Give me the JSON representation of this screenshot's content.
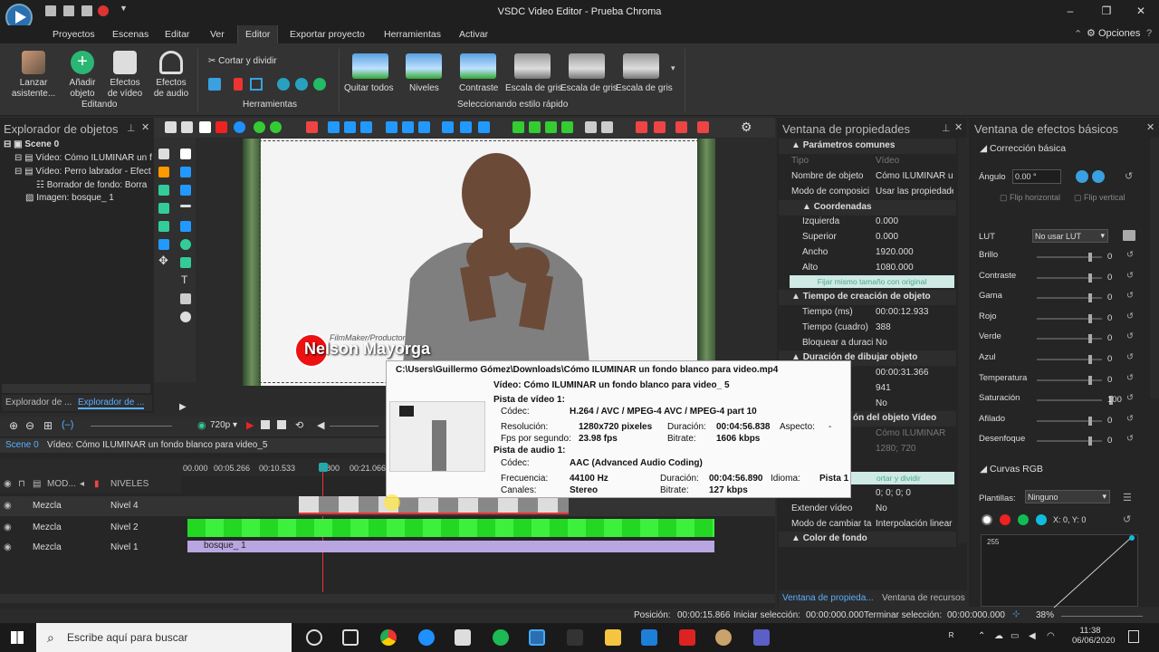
{
  "app": {
    "title": "VSDC Video Editor - Prueba Chroma",
    "options": "Opciones"
  },
  "menu": [
    "Proyectos",
    "Escenas",
    "Editar",
    "Ver",
    "Editor",
    "Exportar proyecto",
    "Herramientas",
    "Activar"
  ],
  "ribbon": {
    "launch": "Lanzar asistente...",
    "add": "Añadir objeto",
    "vfx": "Efectos de vídeo",
    "afx": "Efectos de audio",
    "cut": "Cortar y dividir",
    "group_edit": "Editando",
    "group_tools": "Herramientas",
    "group_style": "Seleccionando estilo rápido",
    "styles": [
      "Quitar todos",
      "Niveles",
      "Contraste",
      "Escala de gris",
      "Escala de gris",
      "Escala de gris"
    ]
  },
  "explorer": {
    "title": "Explorador de objetos",
    "items": [
      "Scene 0",
      "Vídeo: Cómo ILUMINAR un f",
      "Vídeo: Perro labrador - Efect",
      "Borrador de fondo: Borra",
      "Imagen: bosque_ 1"
    ],
    "tabs": [
      "Explorador de ...",
      "Explorador de ..."
    ]
  },
  "video_overlay": {
    "brand": "Nelson Mayorga",
    "sub": "FilmMaker/Productor"
  },
  "props": {
    "title": "Ventana de propiedades",
    "common": "Parámetros comunes",
    "rows": [
      [
        "Tipo",
        "Vídeo"
      ],
      [
        "Nombre de objeto",
        "Cómo ILUMINAR un"
      ],
      [
        "Modo de composici",
        "Usar las propiedades"
      ]
    ],
    "coords": "Coordenadas",
    "coord_rows": [
      [
        "Izquierda",
        "0.000"
      ],
      [
        "Superior",
        "0.000"
      ],
      [
        "Ancho",
        "1920.000"
      ],
      [
        "Alto",
        "1080.000"
      ]
    ],
    "fit_btn": "Fijar mismo tamaño con original",
    "time_sec": "Tiempo de creación de objeto",
    "time_rows": [
      [
        "Tiempo (ms)",
        "00:00:12.933"
      ],
      [
        "Tiempo (cuadro)",
        "388"
      ],
      [
        "Bloquear a duraci",
        "No"
      ]
    ],
    "draw_sec": "Duración de dibujar objeto",
    "draw_rows": [
      "00:00:31.366",
      "941",
      "No"
    ],
    "video_sec": "ón del objeto Vídeo",
    "extra": [
      "Cómo ILUMINAR",
      "1280; 720",
      "ortar y dividir",
      "0; 0; 0; 0"
    ],
    "bottom_rows": [
      [
        "Extender vídeo",
        "No"
      ],
      [
        "Modo de cambiar ta",
        "Interpolación linear"
      ]
    ],
    "bg_sec": "Color de fondo",
    "tabs": [
      "Ventana de propieda...",
      "Ventana de recursos"
    ]
  },
  "effects": {
    "title": "Ventana de efectos básicos",
    "section": "Corrección básica",
    "angle_label": "Ángulo",
    "angle_val": "0.00 °",
    "flip_h": "Flip horizontal",
    "flip_v": "Flip vertical",
    "lut_label": "LUT",
    "lut_val": "No usar LUT",
    "rows": [
      [
        "Brillo",
        "0"
      ],
      [
        "Contraste",
        "0"
      ],
      [
        "Gama",
        "0"
      ],
      [
        "Rojo",
        "0"
      ],
      [
        "Verde",
        "0"
      ],
      [
        "Azul",
        "0"
      ],
      [
        "Temperatura",
        "0"
      ],
      [
        "Saturación",
        "100"
      ],
      [
        "Afilado",
        "0"
      ],
      [
        "Desenfoque",
        "0"
      ]
    ],
    "curves": "Curvas RGB",
    "templates_label": "Plantillas:",
    "templates_val": "Ninguno",
    "coords": "X: 0, Y: 0",
    "curve_top": "255"
  },
  "timeline": {
    "res": "720p",
    "scene": "Scene 0",
    "crumb": "Vídeo: Cómo ILUMINAR un fondo blanco para video_5",
    "header": [
      "MOD...",
      "NIVELES"
    ],
    "ruler": [
      "00.000",
      "00:05.266",
      "00:10.533",
      "800",
      "00:21.066"
    ],
    "tracks": [
      [
        "Mezcla",
        "Nivel 4"
      ],
      [
        "Mezcla",
        "Nivel 2"
      ],
      [
        "Mezcla",
        "Nivel 1"
      ]
    ],
    "image_clip": "bosque_ 1"
  },
  "tooltip": {
    "path": "C:\\Users\\Guillermo Gómez\\Downloads\\Cómo ILUMINAR un fondo blanco para video.mp4",
    "video_name": "Vídeo: Cómo ILUMINAR un fondo blanco para video_ 5",
    "v_track": "Pista de vídeo 1:",
    "codec_l": "Códec:",
    "codec_v": "H.264 / AVC / MPEG-4 AVC / MPEG-4 part 10",
    "res_l": "Resolución:",
    "res_v": "1280x720 pixeles",
    "dur_l": "Duración:",
    "dur_v": "00:04:56.838",
    "asp_l": "Aspecto:",
    "asp_v": "-",
    "fps_l": "Fps por segundo:",
    "fps_v": "23.98 fps",
    "br_l": "Bitrate:",
    "br_v": "1606 kbps",
    "a_track": "Pista de audio 1:",
    "acodec_v": "AAC (Advanced Audio Coding)",
    "freq_l": "Frecuencia:",
    "freq_v": "44100 Hz",
    "adur_v": "00:04:56.890",
    "lang_l": "Idioma:",
    "lang_v": "Pista 1",
    "ch_l": "Canales:",
    "ch_v": "Stereo",
    "abr_v": "127 kbps"
  },
  "status": {
    "pos_l": "Posición:",
    "pos_v": "00:00:15.866",
    "start_l": "Iniciar selección:",
    "start_v": "00:00:000.000",
    "end_l": "Terminar selección:",
    "end_v": "00:00:000.000",
    "zoom": "38%"
  },
  "taskbar": {
    "search": "Escribe aquí para buscar",
    "time": "11:38",
    "date": "06/06/2020"
  }
}
